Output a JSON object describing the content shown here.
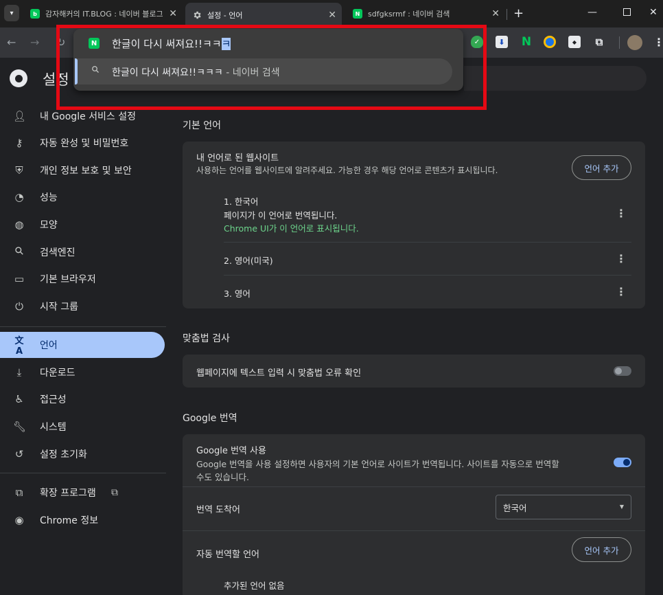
{
  "tabs": [
    {
      "title": "감자해커의 IT.BLOG : 네이버 블로그",
      "favicon": "blog-favicon",
      "color": "#03c75a"
    },
    {
      "title": "설정 - 언어",
      "favicon": "gear-icon",
      "active": true
    },
    {
      "title": "sdfgksrmf : 네이버 검색",
      "favicon": "naver-favicon",
      "color": "#03c75a"
    }
  ],
  "omnibox": {
    "input_text": "한글이 다시 써져요!!ㅋㅋ",
    "input_selected": "ㅋ",
    "suggestion_text": "한글이 다시 써져요!!ㅋㅋㅋ",
    "suggestion_suffix": " - 네이버 검색"
  },
  "page_title": "설정",
  "sidebar": {
    "items": [
      {
        "label": "내 Google 서비스 설정",
        "icon": "person-icon"
      },
      {
        "label": "자동 완성 및 비밀번호",
        "icon": "key-icon"
      },
      {
        "label": "개인 정보 보호 및 보안",
        "icon": "shield-icon"
      },
      {
        "label": "성능",
        "icon": "speedometer-icon"
      },
      {
        "label": "모양",
        "icon": "palette-icon"
      },
      {
        "label": "검색엔진",
        "icon": "search-icon"
      },
      {
        "label": "기본 브라우저",
        "icon": "browser-icon"
      },
      {
        "label": "시작 그룹",
        "icon": "power-icon"
      },
      {
        "label": "언어",
        "icon": "translate-icon",
        "active": true
      },
      {
        "label": "다운로드",
        "icon": "download-icon"
      },
      {
        "label": "접근성",
        "icon": "accessibility-icon"
      },
      {
        "label": "시스템",
        "icon": "wrench-icon"
      },
      {
        "label": "설정 초기화",
        "icon": "reset-icon"
      },
      {
        "label": "확장 프로그램",
        "icon": "extension-icon"
      },
      {
        "label": "Chrome 정보",
        "icon": "chrome-icon"
      }
    ]
  },
  "preferred_languages": {
    "section_title": "기본 언어",
    "card_title": "내 언어로 된 웹사이트",
    "card_desc": "사용하는 언어를 웹사이트에 알려주세요. 가능한 경우 해당 언어로 콘텐츠가 표시됩니다.",
    "add_button": "언어 추가",
    "languages": [
      {
        "name": "1. 한국어",
        "line1": "페이지가 이 언어로 번역됩니다.",
        "line2": "Chrome UI가 이 언어로 표시됩니다."
      },
      {
        "name": "2. 영어(미국)"
      },
      {
        "name": "3. 영어"
      }
    ]
  },
  "spell_check": {
    "section_title": "맞춤법 검사",
    "label": "웹페이지에 텍스트 입력 시 맞춤법 오류 확인",
    "enabled": false
  },
  "google_translate": {
    "section_title": "Google 번역",
    "use_label": "Google 번역 사용",
    "use_desc_1": "Google 번역을 사용 설정하면 사용자의 기본 언어로 사이트가 번역됩니다. 사이트를 자동으로 번역할",
    "use_desc_2": "수도 있습니다.",
    "enabled": true,
    "target_label": "번역 도착어",
    "target_value": "한국어",
    "auto_label": "자동 번역할 언어",
    "auto_add_button": "언어 추가",
    "auto_empty": "추가된 언어 없음"
  },
  "colors": {
    "accent": "#a8c7fa",
    "highlight_border": "#e50914",
    "naver_green": "#03c75a"
  }
}
